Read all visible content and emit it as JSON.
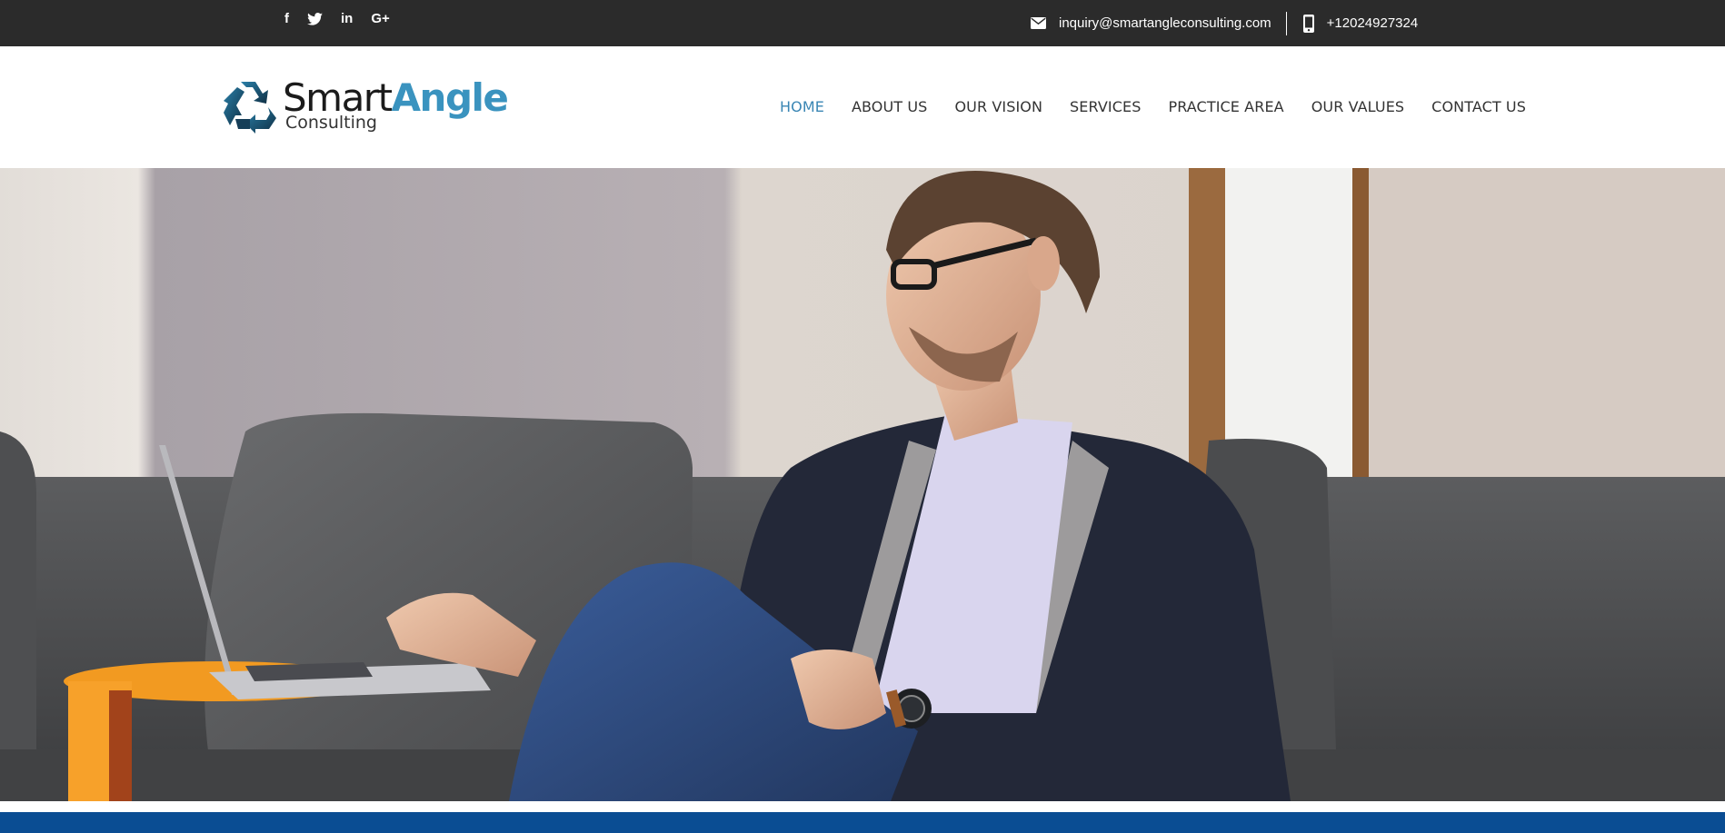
{
  "topbar": {
    "social": [
      {
        "name": "facebook",
        "glyph": "f"
      },
      {
        "name": "twitter",
        "glyph": ""
      },
      {
        "name": "linkedin",
        "glyph": "in"
      },
      {
        "name": "google-plus",
        "glyph": "G+"
      }
    ],
    "email": "inquiry@smartangleconsulting.com",
    "phone": "+12024927324",
    "icons": {
      "email": "envelope-icon",
      "phone": "mobile-phone-icon"
    }
  },
  "logo": {
    "brand_part1": "Smart",
    "brand_part2": "Angle",
    "subtitle": "Consulting",
    "icon": "recycle-arrows-icon"
  },
  "nav": {
    "items": [
      {
        "label": "HOME",
        "active": true
      },
      {
        "label": "ABOUT US",
        "active": false
      },
      {
        "label": "OUR VISION",
        "active": false
      },
      {
        "label": "SERVICES",
        "active": false
      },
      {
        "label": "PRACTICE AREA",
        "active": false
      },
      {
        "label": "OUR VALUES",
        "active": false
      },
      {
        "label": "CONTACT US",
        "active": false
      }
    ]
  },
  "hero": {
    "image": "man-with-laptop-on-sofa-photo"
  },
  "colors": {
    "topbar_bg": "#2b2b2b",
    "accent": "#3a93bf",
    "nav_active": "#3a86b4",
    "footer_band": "#0a4d93"
  }
}
